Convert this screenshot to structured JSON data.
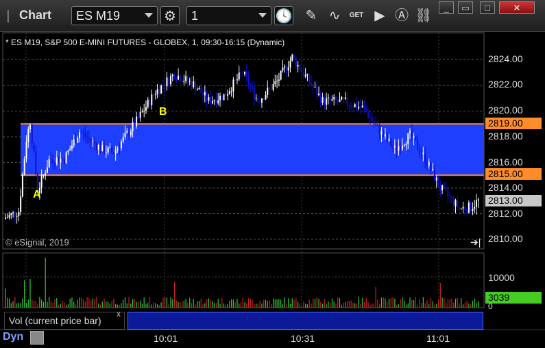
{
  "window": {
    "title": "Chart",
    "symbol": "ES M19",
    "interval": "1",
    "buttons": {
      "minimize": "_",
      "restore": "▭",
      "maximize": "□",
      "close": "✕"
    }
  },
  "toolbar_icons": [
    "clock-icon",
    "pencil-icon",
    "study-icon",
    "get-icon",
    "play-icon",
    "alert-icon",
    "link-icon"
  ],
  "get_label": "GET",
  "chart": {
    "header": "* ES M19, S&P 500 E-MINI FUTURES - GLOBEX, 1, 09:30-16:15 (Dynamic)",
    "copyright": "© eSignal, 2019",
    "price_axis": [
      "2824.00",
      "2822.00",
      "2820.00",
      "2818.00",
      "2816.00",
      "2814.00",
      "2812.00",
      "2810.00"
    ],
    "upper_level": "2819.00",
    "lower_level": "2815.00",
    "last_price": "2813.00",
    "marker_a": "A",
    "marker_b": "B",
    "volume_axis": "10000",
    "volume_zero": "0",
    "volume_last": "3039",
    "time_axis": [
      "10:01",
      "10:31",
      "11:01"
    ],
    "colors": {
      "zone": "#1f3fff",
      "level": "#ff8c2a",
      "up": "#ffffff",
      "down": "#1010d0",
      "vol_up": "#33cc33",
      "vol_down": "#cc2222",
      "last": "#c8c8c8",
      "vol_last": "#44cc22"
    }
  },
  "panel": {
    "label": "Vol (current price bar)",
    "close": "x"
  },
  "status": {
    "mode": "Dyn"
  }
}
